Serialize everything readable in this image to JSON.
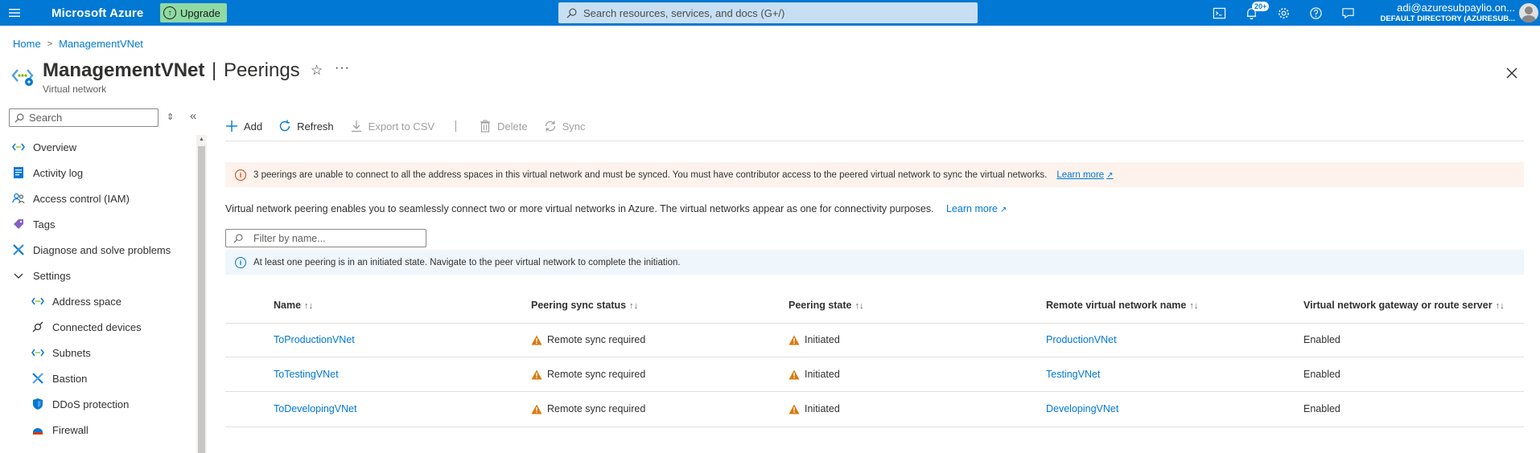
{
  "topbar": {
    "brand": "Microsoft Azure",
    "upgrade_label": "Upgrade",
    "search_placeholder": "Search resources, services, and docs (G+/)",
    "notification_count": "20+",
    "account_email": "adi@azuresubpaylio.on...",
    "account_directory": "DEFAULT DIRECTORY (AZURESUB..."
  },
  "breadcrumb": {
    "home": "Home",
    "current": "ManagementVNet"
  },
  "header": {
    "resource_name": "ManagementVNet",
    "separator": "|",
    "blade_name": "Peerings",
    "resource_type": "Virtual network"
  },
  "sidebar": {
    "search_placeholder": "Search",
    "items": [
      {
        "label": "Overview",
        "icon": "overview-icon"
      },
      {
        "label": "Activity log",
        "icon": "activity-log-icon"
      },
      {
        "label": "Access control (IAM)",
        "icon": "iam-icon"
      },
      {
        "label": "Tags",
        "icon": "tag-icon"
      },
      {
        "label": "Diagnose and solve problems",
        "icon": "wrench-icon"
      },
      {
        "label": "Settings",
        "icon": "chevron-down-icon"
      },
      {
        "label": "Address space",
        "icon": "address-space-icon"
      },
      {
        "label": "Connected devices",
        "icon": "plug-icon"
      },
      {
        "label": "Subnets",
        "icon": "subnet-icon"
      },
      {
        "label": "Bastion",
        "icon": "bastion-icon"
      },
      {
        "label": "DDoS protection",
        "icon": "shield-icon"
      },
      {
        "label": "Firewall",
        "icon": "firewall-icon"
      }
    ]
  },
  "toolbar": {
    "add": "Add",
    "refresh": "Refresh",
    "export": "Export to CSV",
    "delete": "Delete",
    "sync": "Sync"
  },
  "warning": {
    "text": "3 peerings are unable to connect to all the address spaces in this virtual network and must be synced. You must have contributor access to the peered virtual network to sync the virtual networks.",
    "link": "Learn more"
  },
  "description": {
    "text": "Virtual network peering enables you to seamlessly connect two or more virtual networks in Azure. The virtual networks appear as one for connectivity purposes.",
    "link": "Learn more"
  },
  "filter_placeholder": "Filter by name...",
  "info": {
    "text": "At least one peering is in an initiated state. Navigate to the peer virtual network to complete the initiation."
  },
  "table": {
    "headers": [
      "Name",
      "Peering sync status",
      "Peering state",
      "Remote virtual network name",
      "Virtual network gateway or route server"
    ],
    "rows": [
      {
        "name": "ToProductionVNet",
        "sync": "Remote sync required",
        "state": "Initiated",
        "remote": "ProductionVNet",
        "gateway": "Enabled"
      },
      {
        "name": "ToTestingVNet",
        "sync": "Remote sync required",
        "state": "Initiated",
        "remote": "TestingVNet",
        "gateway": "Enabled"
      },
      {
        "name": "ToDevelopingVNet",
        "sync": "Remote sync required",
        "state": "Initiated",
        "remote": "DevelopingVNet",
        "gateway": "Enabled"
      }
    ]
  },
  "colors": {
    "accent": "#0078d4",
    "warning": "#d83b01",
    "warning_triangle": "#d97a11"
  }
}
